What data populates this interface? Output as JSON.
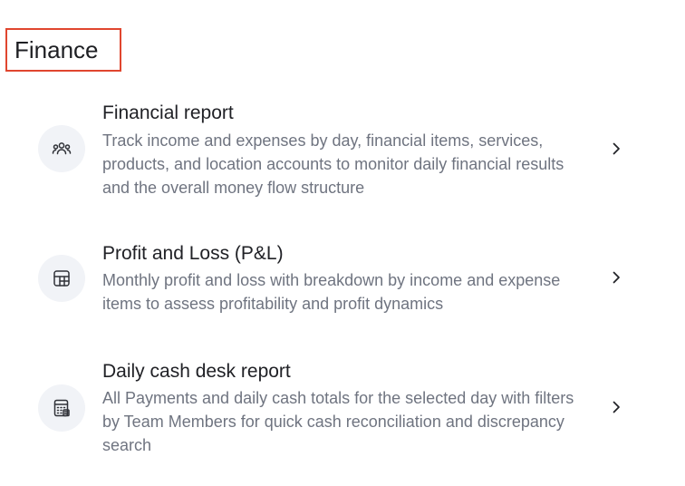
{
  "section": {
    "title": "Finance"
  },
  "items": [
    {
      "icon": "users-group-icon",
      "title": "Financial report",
      "description": "Track income and expenses by day, financial items, services, products, and location accounts to monitor daily financial results and the overall money flow structure"
    },
    {
      "icon": "table-grid-icon",
      "title": "Profit and Loss (P&L)",
      "description": "Monthly profit and loss with breakdown by income and expense items to assess profitability and profit dynamics"
    },
    {
      "icon": "calculator-icon",
      "title": "Daily cash desk report",
      "description": "All Payments and daily cash totals for the selected day with filters by Team Members for quick cash reconciliation and discrepancy search"
    }
  ],
  "colors": {
    "highlight_border": "#e0462f",
    "icon_background": "#f1f3f7",
    "description_text": "#6f7480"
  }
}
